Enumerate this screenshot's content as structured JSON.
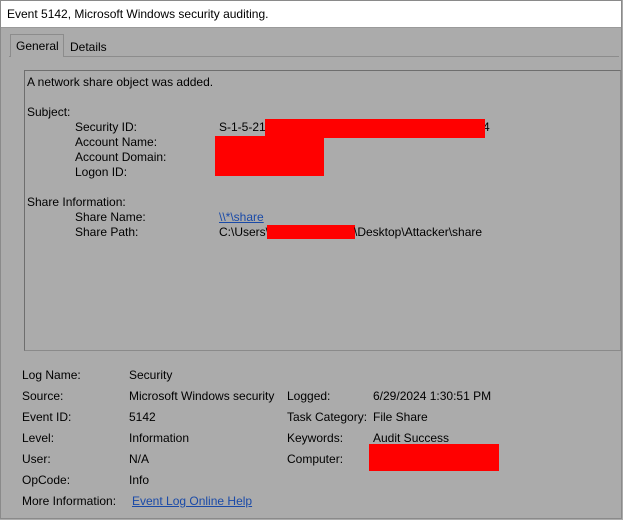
{
  "window": {
    "title": "Event 5142, Microsoft Windows security auditing."
  },
  "tabs": [
    {
      "label": "General",
      "selected": true
    },
    {
      "label": "Details",
      "selected": false
    }
  ],
  "description": {
    "summary": "A network share object was added.",
    "subject_heading": "Subject:",
    "security_id_label": "Security ID:",
    "security_id_prefix": "S-1-5-21",
    "security_id_suffix": "4",
    "account_name_label": "Account Name:",
    "account_domain_label": "Account Domain:",
    "logon_id_label": "Logon ID:",
    "share_heading": "Share Information:",
    "share_name_label": "Share Name:",
    "share_name_value": "\\\\*\\share",
    "share_path_label": "Share Path:",
    "share_path_prefix": "C:\\Users\\",
    "share_path_suffix": "\\Desktop\\Attacker\\share"
  },
  "details": {
    "log_name_label": "Log Name:",
    "log_name": "Security",
    "source_label": "Source:",
    "source": "Microsoft Windows security",
    "logged_label": "Logged:",
    "logged": "6/29/2024 1:30:51 PM",
    "event_id_label": "Event ID:",
    "event_id": "5142",
    "task_category_label": "Task Category:",
    "task_category": "File Share",
    "level_label": "Level:",
    "level": "Information",
    "keywords_label": "Keywords:",
    "keywords": "Audit Success",
    "user_label": "User:",
    "user": "N/A",
    "computer_label": "Computer:",
    "opcode_label": "OpCode:",
    "opcode": "Info",
    "more_info_label": "More Information:",
    "more_info_link": "Event Log Online Help"
  },
  "colors": {
    "background": "#ababab",
    "redaction": "#ff0000",
    "link": "#1a4aa8"
  }
}
